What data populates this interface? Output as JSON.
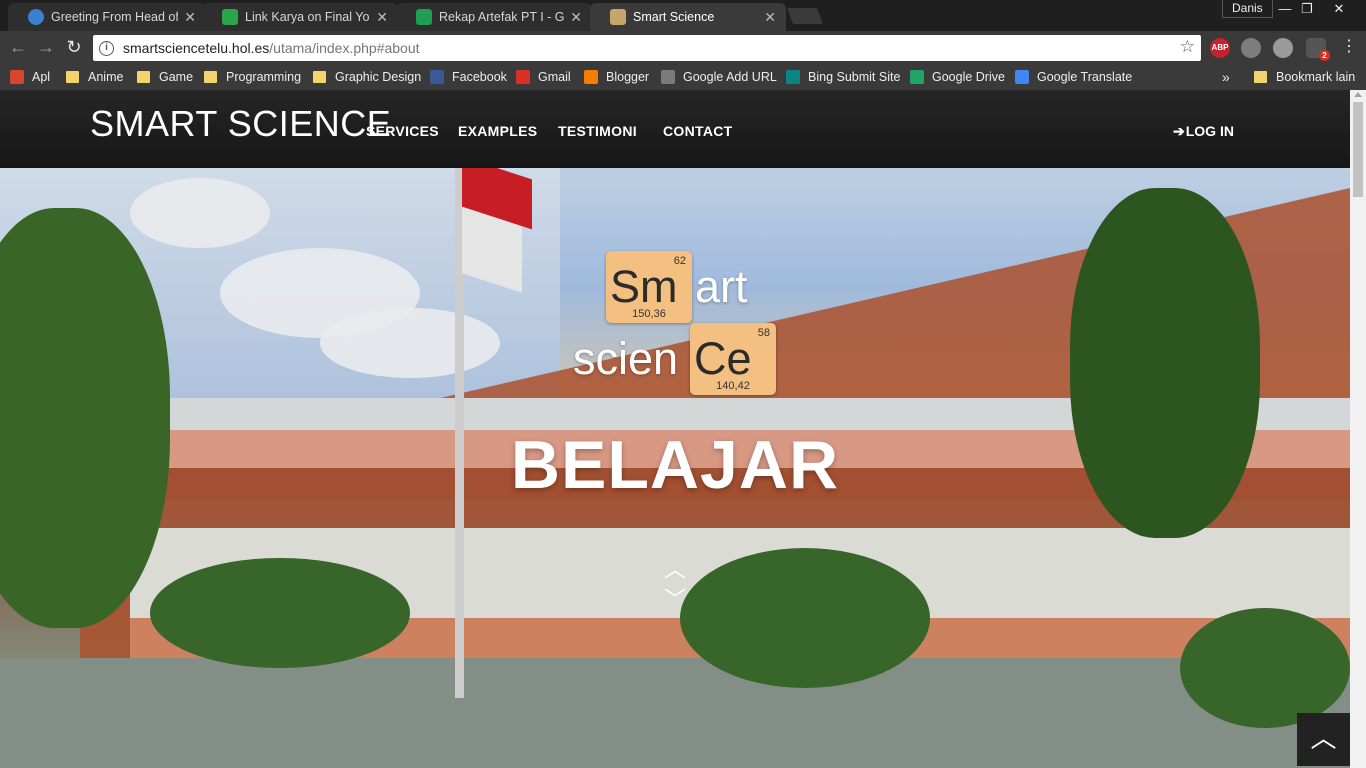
{
  "browser": {
    "tabs": [
      {
        "title": "Greeting From Head of P",
        "icon": "globe-icon",
        "color": "#3b7fd0",
        "active": false
      },
      {
        "title": "Link Karya on Final Yosh |",
        "icon": "trello-icon",
        "color": "#2aa54a",
        "active": false
      },
      {
        "title": "Rekap Artefak PT I - Goo",
        "icon": "sheets-icon",
        "color": "#1f9d55",
        "active": false
      },
      {
        "title": "Smart Science",
        "icon": "site-icon",
        "color": "#c9a56b",
        "active": true
      }
    ],
    "profile": "Danis",
    "window_controls": {
      "minimize": "—",
      "restore": "❐",
      "close": "✕"
    },
    "url_host": "smartsciencetelu.hol.es",
    "url_path": "/utama/index.php#about",
    "extensions": [
      "ABP",
      "globe",
      "cloud",
      "2"
    ],
    "bookmarks": [
      {
        "label": "Apl",
        "icon": "apps-icon",
        "color": "#d9442e"
      },
      {
        "label": "Anime",
        "icon": "folder-icon",
        "color": "#f3d36b"
      },
      {
        "label": "Game",
        "icon": "folder-icon",
        "color": "#f3d36b"
      },
      {
        "label": "Programming",
        "icon": "folder-icon",
        "color": "#f3d36b"
      },
      {
        "label": "Graphic Design",
        "icon": "folder-icon",
        "color": "#f3d36b"
      },
      {
        "label": "Facebook",
        "icon": "facebook-icon",
        "color": "#3b5998"
      },
      {
        "label": "Gmail",
        "icon": "gmail-icon",
        "color": "#d93025"
      },
      {
        "label": "Blogger",
        "icon": "blogger-icon",
        "color": "#f57d00"
      },
      {
        "label": "Google Add URL",
        "icon": "google-icon",
        "color": "#7a7a7a"
      },
      {
        "label": "Bing Submit Site",
        "icon": "bing-icon",
        "color": "#0b8484"
      },
      {
        "label": "Google Drive",
        "icon": "drive-icon",
        "color": "#1fa463"
      },
      {
        "label": "Google Translate",
        "icon": "translate-icon",
        "color": "#4285f4"
      }
    ],
    "bookmarks_overflow": "»",
    "other_bookmarks": "Bookmark lain"
  },
  "site": {
    "brand": "SMART SCIENCE",
    "nav": [
      "SERVICES",
      "EXAMPLES",
      "TESTIMONI",
      "CONTACT"
    ],
    "login": "LOG IN",
    "logo": {
      "cell1": {
        "symbol": "Sm",
        "number": "62",
        "mass": "150,36"
      },
      "rest1": "art",
      "prefix2": "scien",
      "cell2": {
        "symbol": "Ce",
        "number": "58",
        "mass": "140,42"
      },
      "cell_color": "#f4c081"
    },
    "headline": "BELAJAR",
    "scroll_up": "⌃",
    "scroll_down": "⌄",
    "back_to_top": "⌃"
  }
}
